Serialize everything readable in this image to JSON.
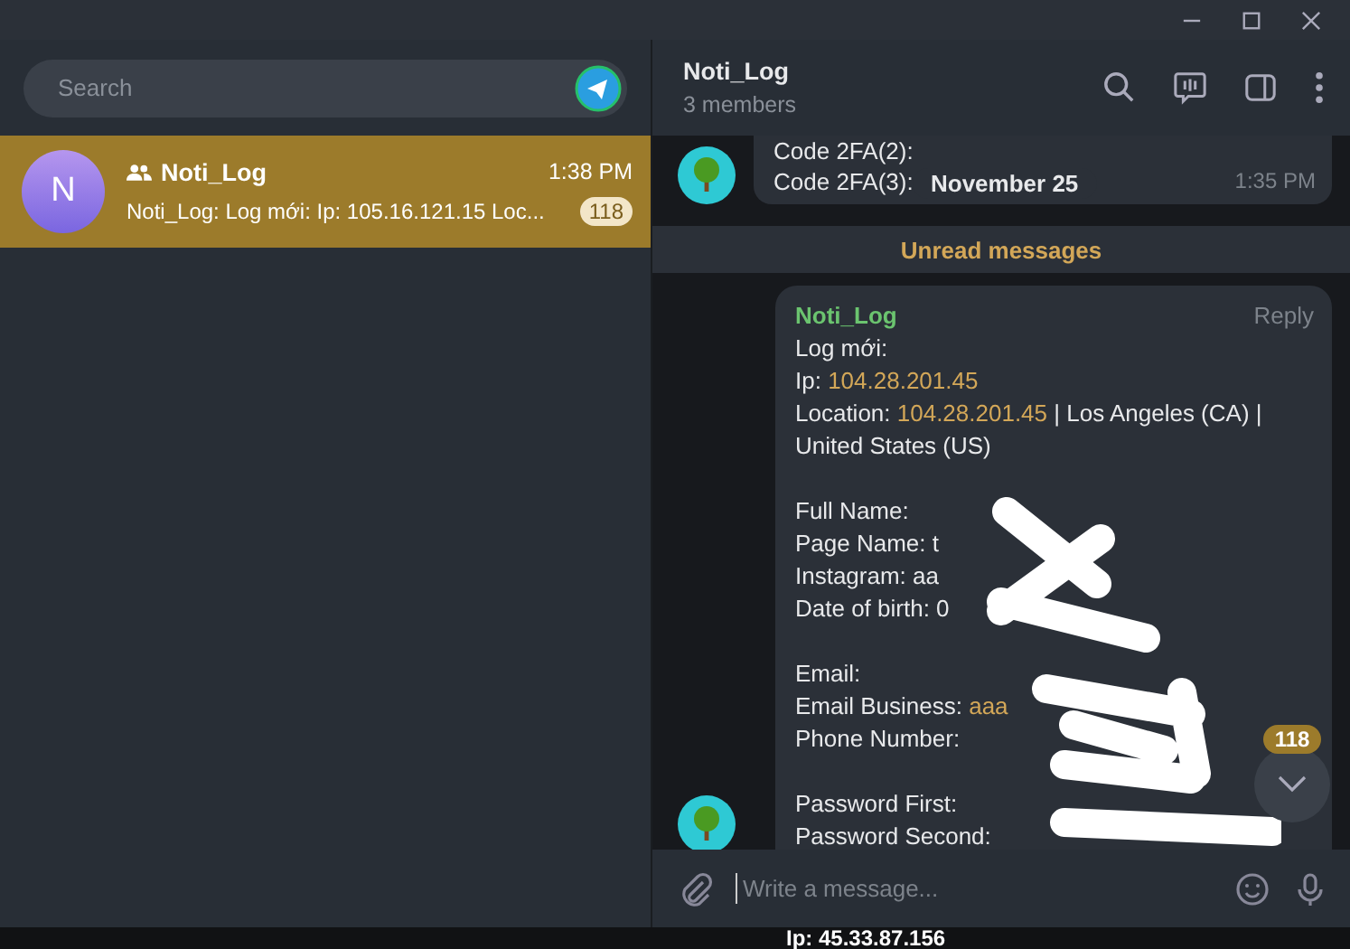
{
  "sidebar": {
    "search": {
      "placeholder": "Search"
    },
    "chats": [
      {
        "initial": "N",
        "name": "Noti_Log",
        "time": "1:38 PM",
        "preview": "Noti_Log: Log mới: Ip: 105.16.121.15 Loc...",
        "unread": "118",
        "selected": true
      }
    ]
  },
  "chat": {
    "title": "Noti_Log",
    "subtitle": "3 members",
    "previous_message": {
      "lines": [
        "Code 2FA(2):",
        "Code 2FA(3):"
      ],
      "time": "1:35 PM"
    },
    "date_pill": "November 25",
    "unread_divider": "Unread messages",
    "message": {
      "sender": "Noti_Log",
      "action": "Reply",
      "lines": [
        {
          "kind": "text",
          "parts": [
            {
              "kind": "plain",
              "text": "Log mới:"
            }
          ]
        },
        {
          "kind": "text",
          "parts": [
            {
              "kind": "plain",
              "text": "Ip: "
            },
            {
              "kind": "link",
              "text": "104.28.201.45"
            }
          ]
        },
        {
          "kind": "text",
          "parts": [
            {
              "kind": "plain",
              "text": "Location: "
            },
            {
              "kind": "link",
              "text": "104.28.201.45"
            },
            {
              "kind": "plain",
              "text": " | Los Angeles (CA) | United States (US)"
            }
          ]
        },
        {
          "kind": "gap"
        },
        {
          "kind": "text",
          "parts": [
            {
              "kind": "plain",
              "text": "Full Name:"
            }
          ]
        },
        {
          "kind": "text",
          "parts": [
            {
              "kind": "plain",
              "text": "Page Name: t"
            }
          ]
        },
        {
          "kind": "text",
          "parts": [
            {
              "kind": "plain",
              "text": "Instagram: aa"
            }
          ]
        },
        {
          "kind": "text",
          "parts": [
            {
              "kind": "plain",
              "text": "Date of birth: 0"
            }
          ]
        },
        {
          "kind": "gap"
        },
        {
          "kind": "text",
          "parts": [
            {
              "kind": "plain",
              "text": "Email:"
            }
          ]
        },
        {
          "kind": "text",
          "parts": [
            {
              "kind": "plain",
              "text": "Email Business: "
            },
            {
              "kind": "link",
              "text": "aaa"
            }
          ]
        },
        {
          "kind": "text",
          "parts": [
            {
              "kind": "plain",
              "text": "Phone Number:"
            }
          ]
        },
        {
          "kind": "gap"
        },
        {
          "kind": "text",
          "parts": [
            {
              "kind": "plain",
              "text": "Password First:"
            }
          ]
        },
        {
          "kind": "text",
          "parts": [
            {
              "kind": "plain",
              "text": "Password Second:"
            }
          ]
        }
      ]
    },
    "scroll_badge": "118",
    "composer": {
      "placeholder": "Write a message..."
    }
  },
  "background_window": {
    "text": "Ip: 45.33.87.156"
  }
}
